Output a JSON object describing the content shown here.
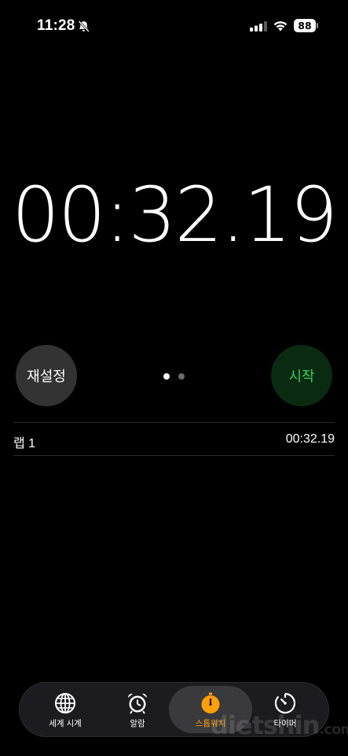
{
  "status_bar": {
    "time": "11:28",
    "battery": "88"
  },
  "stopwatch": {
    "display": "00:32.19"
  },
  "controls": {
    "reset_label": "재설정",
    "start_label": "시작"
  },
  "laps": [
    {
      "label": "랩 1",
      "time": "00:32.19"
    }
  ],
  "tabs": [
    {
      "label": "세계 시계",
      "icon": "globe-icon",
      "active": false
    },
    {
      "label": "알람",
      "icon": "alarm-clock-icon",
      "active": false
    },
    {
      "label": "스톱워치",
      "icon": "stopwatch-icon",
      "active": true
    },
    {
      "label": "타이머",
      "icon": "timer-icon",
      "active": false
    }
  ],
  "watermark": {
    "text": "dietshin",
    "suffix": ".com"
  },
  "colors": {
    "background": "#000000",
    "reset_button": "#333333",
    "start_button_bg": "#0a2a12",
    "start_button_text": "#32d158",
    "active_tab": "#ff9f0a"
  }
}
